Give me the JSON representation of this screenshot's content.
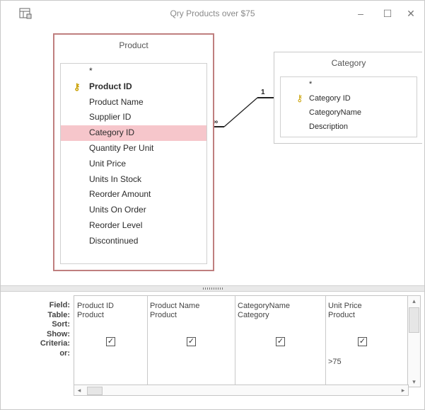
{
  "window": {
    "title": "Qry Products over $75",
    "minimize": "–",
    "maximize": "☐",
    "close": "✕"
  },
  "tables": {
    "product": {
      "name": "Product",
      "fields": [
        "*",
        "Product ID",
        "Product Name",
        "Supplier ID",
        "Category ID",
        "Quantity Per Unit",
        "Unit Price",
        "Units In Stock",
        "Reorder Amount",
        "Units On Order",
        "Reorder Level",
        "Discontinued"
      ],
      "primary_key": "Product ID",
      "selected": "Category ID"
    },
    "category": {
      "name": "Category",
      "fields": [
        "*",
        "Category ID",
        "CategoryName",
        "Description"
      ],
      "primary_key": "Category ID"
    }
  },
  "relationship": {
    "one_label": "1",
    "many_label": "∞"
  },
  "grid": {
    "row_labels": [
      "Field:",
      "Table:",
      "Sort:",
      "Show:",
      "Criteria:",
      "or:"
    ],
    "columns": [
      {
        "field": "Product ID",
        "table": "Product",
        "sort": "",
        "show": true,
        "criteria": "",
        "or": ""
      },
      {
        "field": "Product Name",
        "table": "Product",
        "sort": "",
        "show": true,
        "criteria": "",
        "or": ""
      },
      {
        "field": "CategoryName",
        "table": "Category",
        "sort": "",
        "show": true,
        "criteria": "",
        "or": ""
      },
      {
        "field": "Unit Price",
        "table": "Product",
        "sort": "",
        "show": true,
        "criteria": ">75",
        "or": ""
      }
    ]
  },
  "icons": {
    "app": "query-icon",
    "key": "key-icon",
    "check": "✓",
    "left_arrow": "◂",
    "right_arrow": "▸",
    "up_arrow": "▴",
    "down_arrow": "▾"
  }
}
